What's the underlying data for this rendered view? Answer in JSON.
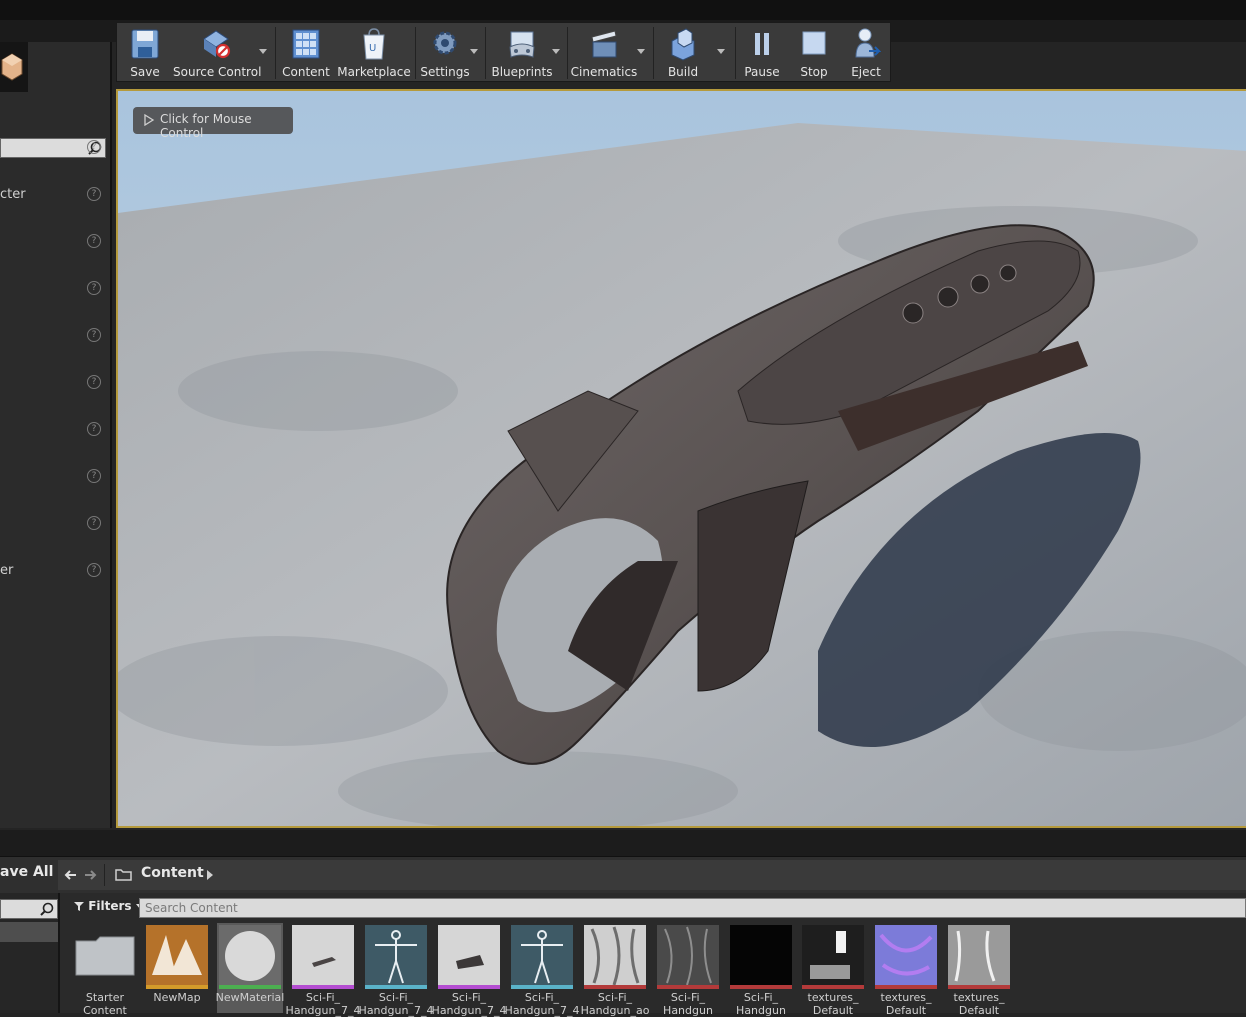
{
  "toolbar": {
    "buttons": [
      {
        "label": "Save",
        "icon": "save-icon"
      },
      {
        "label": "Source Control",
        "icon": "source-control-icon"
      },
      {
        "label": "Content",
        "icon": "content-icon"
      },
      {
        "label": "Marketplace",
        "icon": "marketplace-icon"
      },
      {
        "label": "Settings",
        "icon": "settings-icon"
      },
      {
        "label": "Blueprints",
        "icon": "blueprints-icon"
      },
      {
        "label": "Cinematics",
        "icon": "cinematics-icon"
      },
      {
        "label": "Build",
        "icon": "build-icon"
      },
      {
        "label": "Pause",
        "icon": "pause-icon"
      },
      {
        "label": "Stop",
        "icon": "stop-icon"
      },
      {
        "label": "Eject",
        "icon": "eject-icon"
      }
    ]
  },
  "left_panel": {
    "items": [
      {
        "label": ""
      },
      {
        "label": "cter"
      },
      {
        "label": ""
      },
      {
        "label": ""
      },
      {
        "label": ""
      },
      {
        "label": ""
      },
      {
        "label": ""
      },
      {
        "label": ""
      },
      {
        "label": ""
      },
      {
        "label": "er"
      }
    ]
  },
  "viewport": {
    "mouse_control_label": "Click for Mouse Control"
  },
  "content_browser": {
    "save_all_label": "ave All",
    "breadcrumb": "Content",
    "filters_label": "Filters",
    "search_placeholder": "Search Content",
    "assets": [
      {
        "line1": "Starter",
        "line2": "Content",
        "kind": "folder",
        "bar": ""
      },
      {
        "line1": "NewMap",
        "line2": "",
        "kind": "map",
        "bar": "#d49b2a"
      },
      {
        "line1": "NewMaterial",
        "line2": "",
        "kind": "material",
        "bar": "#4caf50"
      },
      {
        "line1": "Sci-Fi_",
        "line2": "Handgun_7_4",
        "kind": "mesh-flat",
        "bar": "#b44dd1"
      },
      {
        "line1": "Sci-Fi_",
        "line2": "Handgun_7_4",
        "kind": "skeleton",
        "bar": "#5ab3c9"
      },
      {
        "line1": "Sci-Fi_",
        "line2": "Handgun_7_4",
        "kind": "mesh-flat2",
        "bar": "#b44dd1"
      },
      {
        "line1": "Sci-Fi_",
        "line2": "Handgun_7_4",
        "kind": "skeleton",
        "bar": "#5ab3c9"
      },
      {
        "line1": "Sci-Fi_",
        "line2": "Handgun_ao",
        "kind": "tex-gray",
        "bar": "#b33a3a"
      },
      {
        "line1": "Sci-Fi_",
        "line2": "Handgun",
        "kind": "tex-dark",
        "bar": "#b33a3a"
      },
      {
        "line1": "Sci-Fi_",
        "line2": "Handgun",
        "kind": "tex-black",
        "bar": "#b33a3a"
      },
      {
        "line1": "textures_",
        "line2": "Default",
        "kind": "tex-mask",
        "bar": "#b33a3a"
      },
      {
        "line1": "textures_",
        "line2": "Default",
        "kind": "tex-normal",
        "bar": "#b33a3a"
      },
      {
        "line1": "textures_",
        "line2": "Default",
        "kind": "tex-gray2",
        "bar": "#b33a3a"
      }
    ]
  }
}
